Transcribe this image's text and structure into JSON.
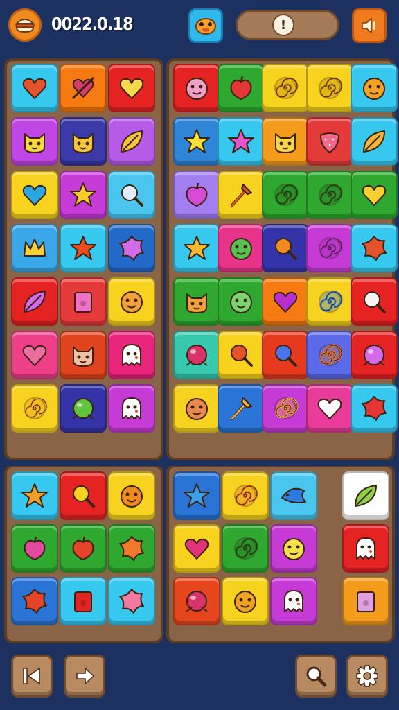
{
  "score_text": "0022.0.18",
  "top_buttons": {
    "menu_icon": "burger-icon",
    "mascot_icon": "mascot-face-icon",
    "hint_glyph": "!",
    "sound_icon": "sound-icon"
  },
  "colors": {
    "background": "#1d3161",
    "panel": "#8a6446",
    "panel_border": "#5b3c25"
  },
  "bottom_buttons": [
    "back-icon",
    "forward-icon",
    "search-icon",
    "gear-icon"
  ],
  "tiles": [
    [
      "#37c8f0",
      "heart",
      "#e5532a"
    ],
    [
      "#f57a12",
      "heart-arrow",
      "#d63a6b"
    ],
    [
      "#e52323",
      "heart",
      "#f7d94b"
    ],
    [
      "#c146e6",
      "cat",
      "#f9da3c"
    ],
    [
      "#3a3aa8",
      "cat",
      "#f2c73b"
    ],
    [
      "#b55be8",
      "leaf",
      "#f4c43c"
    ],
    [
      "#f7d21e",
      "heart",
      "#2ea6e0"
    ],
    [
      "#c73bd8",
      "star",
      "#f6cd2b"
    ],
    [
      "#4ac6ee",
      "magnifier",
      "#e0eefe"
    ],
    [
      "#3aa7e8",
      "crown",
      "#f8d236"
    ],
    [
      "#37c8f0",
      "star",
      "#ea4b1b"
    ],
    [
      "#2369c7",
      "flower",
      "#d36ae8"
    ],
    [
      "#e52323",
      "leaf",
      "#d36ae8"
    ],
    [
      "#e53a3a",
      "square",
      "#f072c8"
    ],
    [
      "#f7d21e",
      "face",
      "#f2a13a"
    ],
    [
      "#ee3f88",
      "heart",
      "#ec6f9f"
    ],
    [
      "#e0441e",
      "cat",
      "#f1bfa6"
    ],
    [
      "#e8247c",
      "ghost",
      "#ffffff"
    ],
    [
      "#f7d21e",
      "spiral",
      "#f0a121"
    ],
    [
      "#3434a8",
      "ball",
      "#62c43e"
    ],
    [
      "#c63bd6",
      "ghost",
      "#ffffff"
    ],
    [
      "#e52323",
      "face",
      "#f2a0c8"
    ],
    [
      "#2fa82f",
      "apple",
      "#e53535"
    ],
    [
      "#f7d21e",
      "spiral",
      "#c48a11"
    ],
    [
      "#f7d21e",
      "spiral",
      "#c48a11"
    ],
    [
      "#37c8f0",
      "face",
      "#f4a226"
    ],
    [
      "#2f86d8",
      "star",
      "#f7e03a"
    ],
    [
      "#37c8f0",
      "star",
      "#e058c9"
    ],
    [
      "#f59b1c",
      "cat",
      "#f7d648"
    ],
    [
      "#e53a3a",
      "strawberry",
      "#f26a8b"
    ],
    [
      "#37c8f0",
      "leaf",
      "#f3b53a"
    ],
    [
      "#a37ef0",
      "apple",
      "#d64bd3"
    ],
    [
      "#f7d21e",
      "tool",
      "#e2531e"
    ],
    [
      "#2fa82f",
      "spiral",
      "#1f6b1f"
    ],
    [
      "#2fa82f",
      "spiral",
      "#1f6b1f"
    ],
    [
      "#2fa82f",
      "heart",
      "#f5d031"
    ],
    [
      "#37c8f0",
      "star",
      "#f4b92f"
    ],
    [
      "#e8338a",
      "face",
      "#59c24f"
    ],
    [
      "#3434a8",
      "magnifier",
      "#f08a1e"
    ],
    [
      "#c63bd6",
      "spiral",
      "#a22ac0"
    ],
    [
      "#37c8f0",
      "flower",
      "#e5532a"
    ],
    [
      "#2fa82f",
      "cat",
      "#f2a13a"
    ],
    [
      "#2fa82f",
      "face",
      "#7ad36b"
    ],
    [
      "#f57a12",
      "heart",
      "#b92ecf"
    ],
    [
      "#f7d21e",
      "spiral",
      "#3a88e0"
    ],
    [
      "#e52323",
      "magnifier",
      "#f4f4f4"
    ],
    [
      "#37c8b0",
      "ball",
      "#d9336b"
    ],
    [
      "#f7d21e",
      "magnifier",
      "#e5532a"
    ],
    [
      "#e53a1e",
      "magnifier",
      "#4a74e8"
    ],
    [
      "#5a6ae8",
      "spiral",
      "#f0731b"
    ],
    [
      "#e52323",
      "ball",
      "#d36ae8"
    ],
    [
      "#f7d21e",
      "face",
      "#e8884a"
    ],
    [
      "#2a74d6",
      "tool",
      "#f3b53a"
    ],
    [
      "#c63bd6",
      "spiral",
      "#f5b233"
    ],
    [
      "#e83b9a",
      "heart",
      "#ffffff"
    ],
    [
      "#37c8f0",
      "flower",
      "#e53535"
    ],
    [
      "#37c8f0",
      "star",
      "#f0a12b"
    ],
    [
      "#e52323",
      "magnifier",
      "#f7d21e"
    ],
    [
      "#f7d21e",
      "face",
      "#f08a1e"
    ],
    [
      "#2fa82f",
      "apple",
      "#e24aa0"
    ],
    [
      "#2fa82f",
      "apple",
      "#e5432a"
    ],
    [
      "#2fa82f",
      "flower",
      "#f07a2a"
    ],
    [
      "#2a74d6",
      "flower",
      "#e5432a"
    ],
    [
      "#37c8f0",
      "square",
      "#e52323"
    ],
    [
      "#37c8f0",
      "flower",
      "#f27aa0"
    ],
    [
      "#2a74d6",
      "star",
      "#3aa0e8"
    ],
    [
      "#f7d21e",
      "spiral",
      "#f07a2a"
    ],
    [
      "#4ac6ee",
      "fish",
      "#2a7ae0"
    ],
    [
      "#ffffff",
      "leaf",
      "#8ed04a"
    ],
    [
      "#f7d21e",
      "heart",
      "#e0337a"
    ],
    [
      "#2fa82f",
      "spiral",
      "#1f6b1f"
    ],
    [
      "#c63bd6",
      "face",
      "#f6e04a"
    ],
    [
      "#e52323",
      "ghost",
      "#ffffff"
    ],
    [
      "#e5461e",
      "ball",
      "#d9336b"
    ],
    [
      "#f7d21e",
      "face",
      "#f0a121"
    ],
    [
      "#c63bd6",
      "ghost",
      "#ffffff"
    ],
    [
      "#f59b1c",
      "square",
      "#e0a0e0"
    ]
  ]
}
